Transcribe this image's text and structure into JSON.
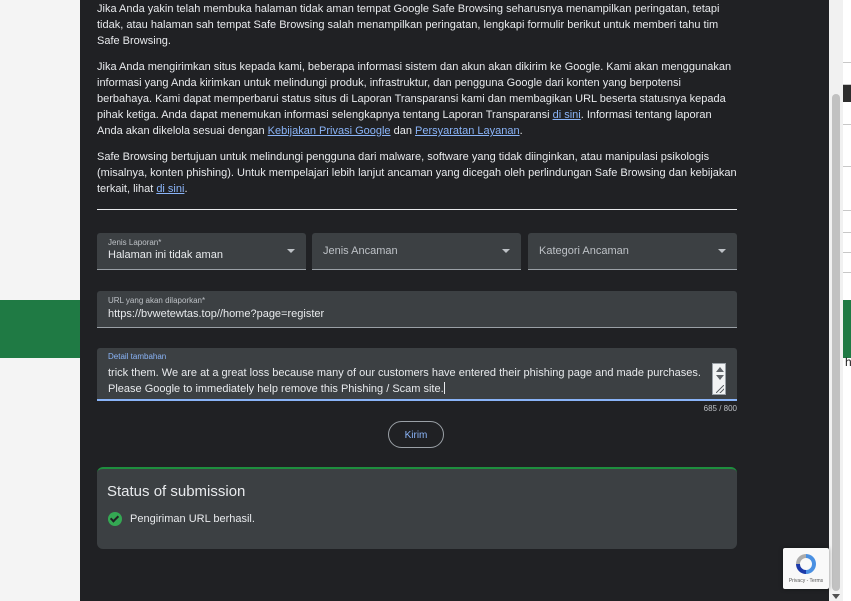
{
  "intro": {
    "p1": "Jika Anda yakin telah membuka halaman tidak aman tempat Google Safe Browsing seharusnya menampilkan peringatan, tetapi tidak, atau halaman sah tempat Safe Browsing salah menampilkan peringatan, lengkapi formulir berikut untuk memberi tahu tim Safe Browsing.",
    "p2_a": "Jika Anda mengirimkan situs kepada kami, beberapa informasi sistem dan akun akan dikirim ke Google. Kami akan menggunakan informasi yang Anda kirimkan untuk melindungi produk, infrastruktur, dan pengguna Google dari konten yang berpotensi berbahaya. Kami dapat memperbarui status situs di Laporan Transparansi kami dan membagikan URL beserta statusnya kepada pihak ketiga. Anda dapat menemukan informasi selengkapnya tentang Laporan Transparansi ",
    "p2_link1": "di sini",
    "p2_b": ". Informasi tentang laporan Anda akan dikelola sesuai dengan ",
    "p2_link2": "Kebijakan Privasi Google",
    "p2_c": " dan ",
    "p2_link3": "Persyaratan Layanan",
    "p2_d": ".",
    "p3_a": "Safe Browsing bertujuan untuk melindungi pengguna dari malware, software yang tidak diinginkan, atau manipulasi psikologis (misalnya, konten phishing). Untuk mempelajari lebih lanjut ancaman yang dicegah oleh perlindungan Safe Browsing dan kebijakan terkait, lihat ",
    "p3_link": "di sini",
    "p3_b": "."
  },
  "form": {
    "report_type": {
      "label": "Jenis Laporan*",
      "value": "Halaman ini tidak aman"
    },
    "threat_type": {
      "placeholder": "Jenis Ancaman"
    },
    "threat_category": {
      "placeholder": "Kategori Ancaman"
    },
    "url": {
      "label": "URL yang akan dilaporkan*",
      "value": "https://bvwetewtas.top//home?page=register"
    },
    "details": {
      "label": "Detail tambahan",
      "value": "trick them. We are at a great loss because many of our customers have entered their phishing page and made purchases.\nPlease Google to immediately help remove this Phishing / Scam site.",
      "counter": "685 / 800"
    },
    "submit_label": "Kirim"
  },
  "status": {
    "title": "Status of submission",
    "message": "Pengiriman URL berhasil."
  },
  "recaptcha": {
    "terms": "Privacy - Terms"
  },
  "background": {
    "right_letter": "h"
  },
  "colors": {
    "dialog_bg": "#202124",
    "field_bg": "#3c4043",
    "link": "#8ab4f8",
    "success": "#34a853"
  }
}
